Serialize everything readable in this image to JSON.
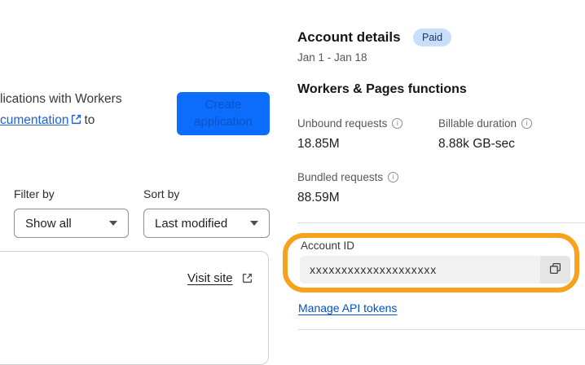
{
  "left": {
    "intro": {
      "line1": "lications with Workers",
      "link": "cumentation",
      "suffix": "to"
    },
    "create_button": "Create application",
    "filter": {
      "label": "Filter by",
      "value": "Show all"
    },
    "sort": {
      "label": "Sort by",
      "value": "Last modified"
    },
    "card": {
      "visit_site": "Visit site"
    }
  },
  "right": {
    "account_details": {
      "title": "Account details",
      "badge": "Paid",
      "date_range": "Jan 1 - Jan 18"
    },
    "usage": {
      "title": "Workers & Pages functions",
      "metrics": [
        {
          "label": "Unbound requests",
          "value": "18.85M"
        },
        {
          "label": "Billable duration",
          "value": "8.88k GB-sec"
        },
        {
          "label": "Bundled requests",
          "value": "88.59M"
        }
      ]
    },
    "account_id": {
      "label": "Account ID",
      "value": "xxxxxxxxxxxxxxxxxxxx"
    },
    "manage_api_tokens": "Manage API tokens"
  },
  "icons": {
    "info": "i"
  },
  "colors": {
    "accent_blue": "#0c6dfd",
    "button_label_blue": "#0b53c8",
    "link_blue": "#1e62d0",
    "deep_link_blue": "#0051c3",
    "badge_bg": "#c9defb",
    "badge_text": "#17335f",
    "annotation_orange": "#f6a21c"
  }
}
